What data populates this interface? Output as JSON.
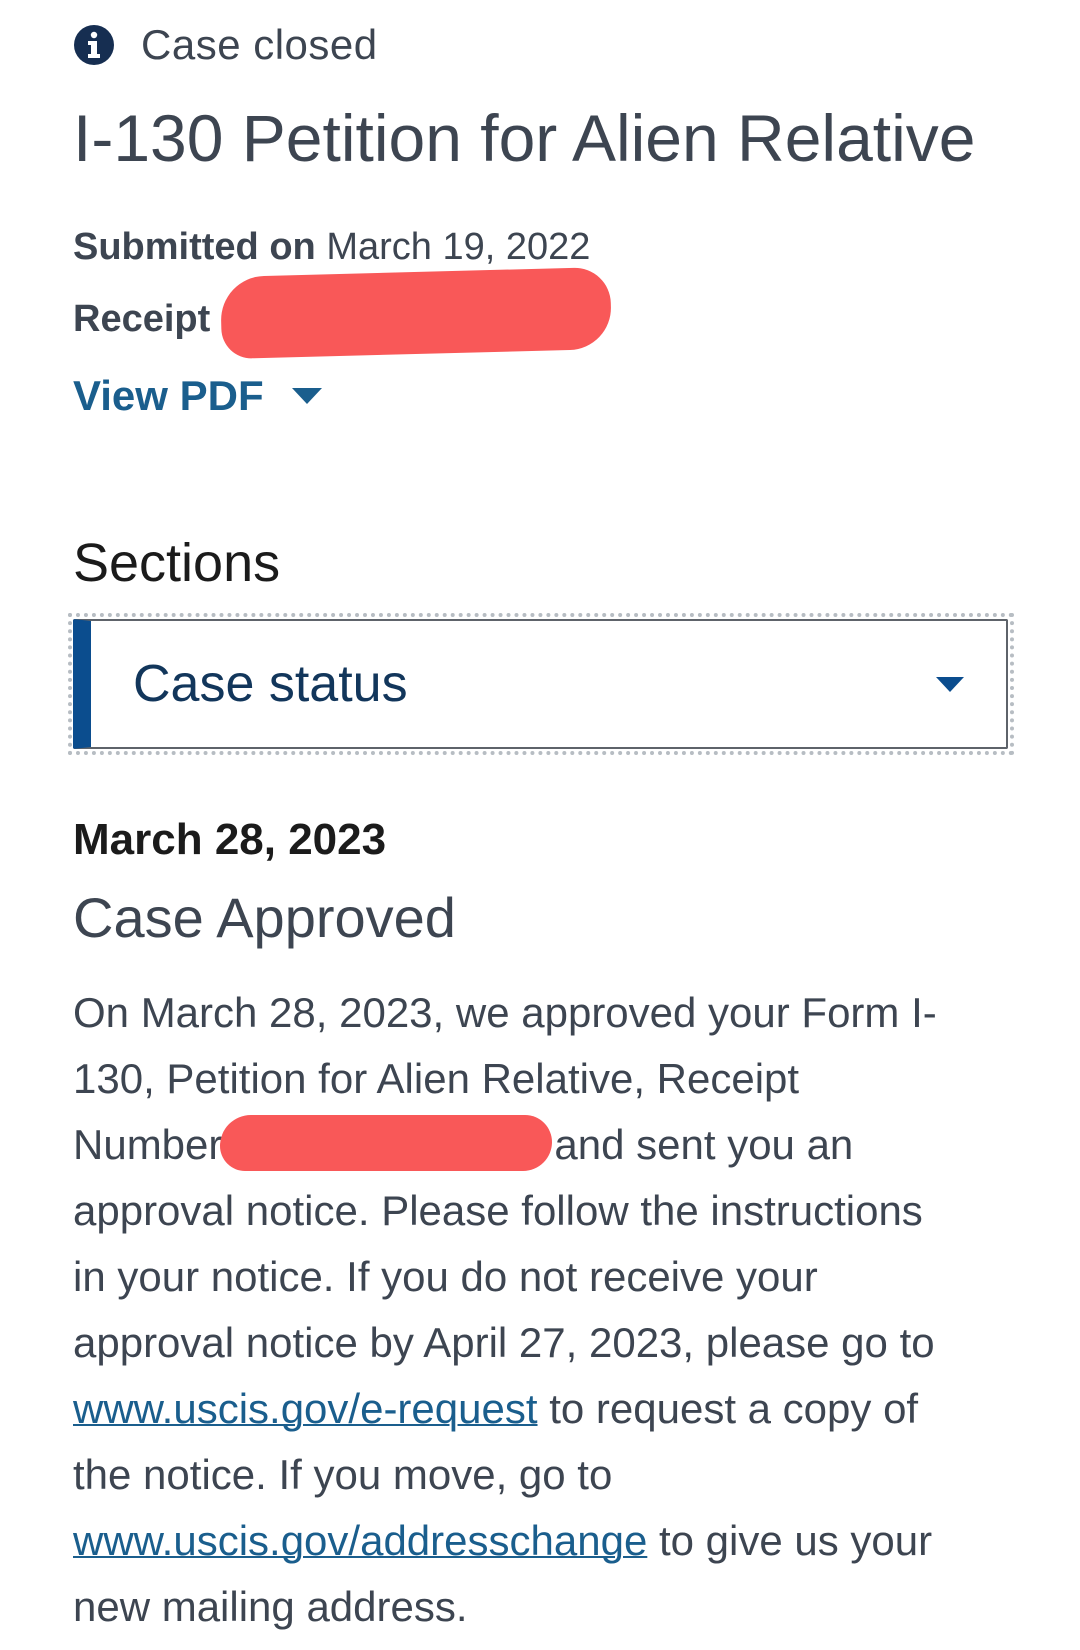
{
  "case_status": {
    "icon": "info-icon",
    "text": "Case closed"
  },
  "form": {
    "title": "I-130 Petition for Alien Relative",
    "submitted_label": "Submitted on",
    "submitted_date": "March 19, 2022",
    "receipt_label": "Receipt #",
    "receipt_value_redacted": true
  },
  "view_pdf": {
    "label": "View PDF",
    "icon": "caret-down-icon"
  },
  "sections": {
    "heading": "Sections",
    "selected": "Case status",
    "icon": "caret-down-icon"
  },
  "event": {
    "date": "March 28, 2023",
    "title": "Case Approved",
    "body": {
      "line1": "On March 28, 2023, we approved your Form I-",
      "line2": "130, Petition for Alien Relative, Receipt",
      "line3_before": "Number",
      "line3_after": "and sent you an",
      "line4": "approval notice. Please follow the instructions",
      "line5": "in your notice. If you do not receive your",
      "line6": "approval notice by April 27, 2023, please go to",
      "link1": "www.uscis.gov/e-request",
      "line7_after": " to request a copy of",
      "line8": "the notice. If you move, go to",
      "link2": "www.uscis.gov/addresschange",
      "line9_after": " to give us your",
      "line10": "new mailing address."
    }
  },
  "colors": {
    "link": "#1a5e8d",
    "select_accent": "#0b4d8e",
    "text": "#3d4551",
    "redaction": "#f95858"
  }
}
